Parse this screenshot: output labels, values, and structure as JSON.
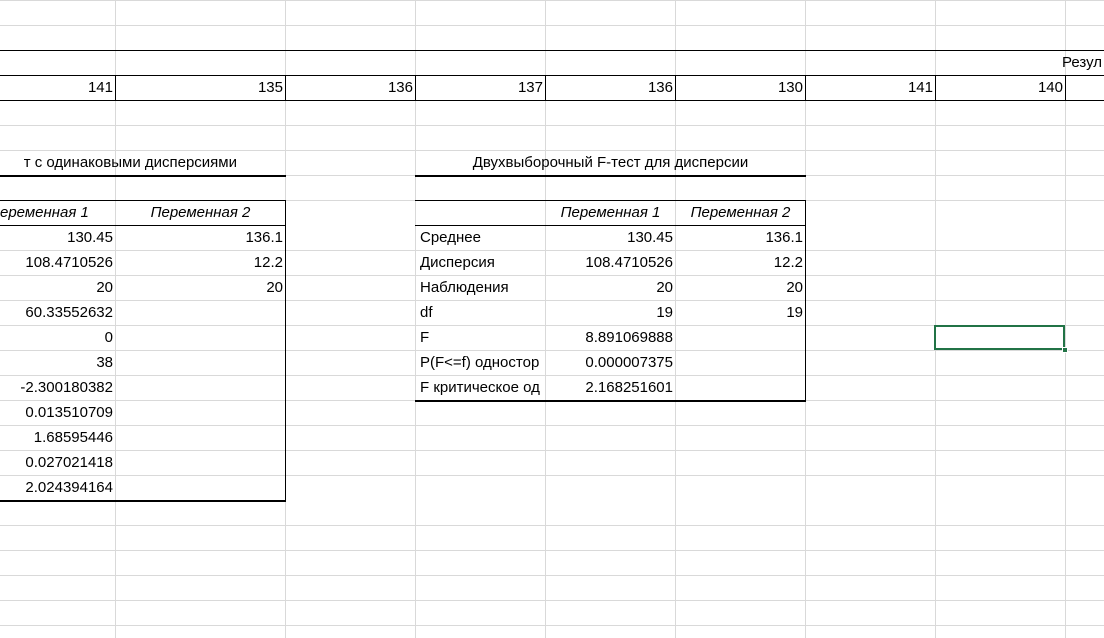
{
  "row_numbers": {
    "values": [
      "141",
      "135",
      "136",
      "137",
      "136",
      "130",
      "141",
      "140"
    ]
  },
  "result_header": "Резул",
  "ttest": {
    "title": "т с одинаковыми дисперсиями",
    "header": [
      "еременная 1",
      "Переменная 2"
    ],
    "var1": [
      "130.45",
      "108.4710526",
      "20",
      "60.33552632",
      "0",
      "38",
      "-2.300180382",
      "0.013510709",
      "1.68595446",
      "0.027021418",
      "2.024394164"
    ],
    "var2": [
      "136.1",
      "12.2",
      "20"
    ]
  },
  "ftest": {
    "title": "Двухвыборочный F-тест для дисперсии",
    "header": [
      "Переменная 1",
      "Переменная 2"
    ],
    "labels": [
      "Среднее",
      "Дисперсия",
      "Наблюдения",
      "df",
      "F",
      "P(F<=f) одностор",
      "F критическое од"
    ],
    "var1": [
      "130.45",
      "108.4710526",
      "20",
      "19",
      "8.891069888",
      "0.000007375",
      "2.168251601"
    ],
    "var2": [
      "136.1",
      "12.2",
      "20",
      "19"
    ]
  }
}
